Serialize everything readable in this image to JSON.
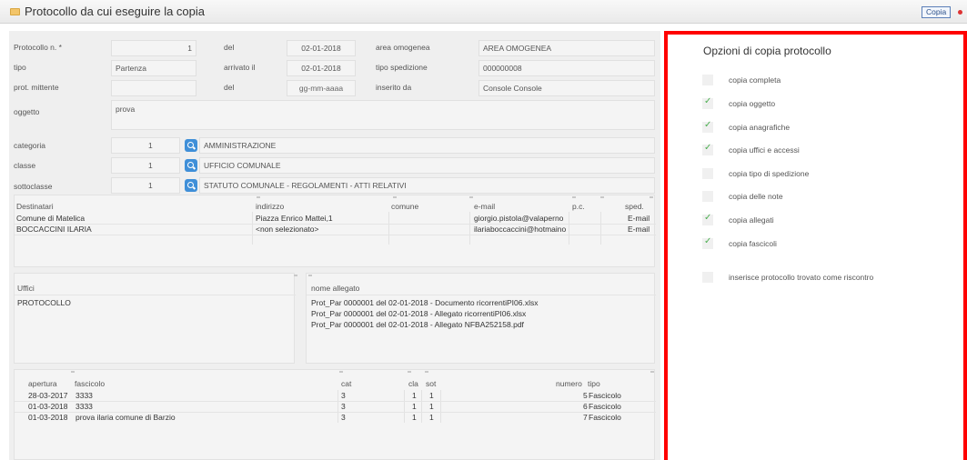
{
  "window": {
    "title": "Protocollo da cui eseguire la copia",
    "copy_button": "Copia"
  },
  "form": {
    "protocollo_label": "Protocollo n. *",
    "protocollo_value": "1",
    "del_label": "del",
    "del_value": "02-01-2018",
    "area_label": "area omogenea",
    "area_value": "AREA OMOGENEA",
    "tipo_label": "tipo",
    "tipo_value": "Partenza",
    "arrivato_label": "arrivato il",
    "arrivato_value": "02-01-2018",
    "spedizione_label": "tipo spedizione",
    "spedizione_value": "000000008",
    "mittente_label": "prot. mittente",
    "mittente_value": "",
    "del2_label": "del",
    "del2_placeholder": "gg-mm-aaaa",
    "inserito_label": "inserito da",
    "inserito_value": "Console Console",
    "oggetto_label": "oggetto",
    "oggetto_value": "prova",
    "categoria_label": "categoria",
    "categoria_num": "1",
    "categoria_value": "AMMINISTRAZIONE",
    "classe_label": "classe",
    "classe_num": "1",
    "classe_value": "UFFICIO COMUNALE",
    "sottoclasse_label": "sottoclasse",
    "sottoclasse_num": "1",
    "sottoclasse_value": "STATUTO COMUNALE - REGOLAMENTI - ATTI RELATIVI"
  },
  "destinatari": {
    "headers": [
      "Destinatari",
      "indirizzo",
      "comune",
      "e-mail",
      "p.c.",
      "sped."
    ],
    "rows": [
      [
        "Comune di Matelica",
        "Piazza Enrico Mattei,1",
        "",
        "giorgio.pistola@valaperno",
        "",
        "E-mail"
      ],
      [
        "BOCCACCINI ILARIA",
        "<non selezionato>",
        "",
        "ilariaboccaccini@hotmaino",
        "",
        "E-mail"
      ]
    ]
  },
  "uffici": {
    "header": "Uffici",
    "rows": [
      "PROTOCOLLO"
    ]
  },
  "allegati": {
    "header": "nome allegato",
    "rows": [
      "Prot_Par 0000001 del 02-01-2018 - Documento ricorrentiPI06.xlsx",
      "Prot_Par 0000001 del 02-01-2018 - Allegato ricorrentiPI06.xlsx",
      "Prot_Par 0000001 del 02-01-2018 - Allegato NFBA252158.pdf"
    ]
  },
  "fascicoli": {
    "headers": [
      "apertura",
      "fascicolo",
      "cat",
      "cla",
      "sot",
      "numero",
      "tipo"
    ],
    "rows": [
      [
        "28-03-2017",
        "3333",
        "3",
        "1",
        "1",
        "5",
        "Fascicolo"
      ],
      [
        "01-03-2018",
        "3333",
        "3",
        "1",
        "1",
        "6",
        "Fascicolo"
      ],
      [
        "01-03-2018",
        "prova ilaria comune di Barzio",
        "3",
        "1",
        "1",
        "7",
        "Fascicolo"
      ]
    ]
  },
  "options": {
    "title": "Opzioni di copia protocollo",
    "items": [
      {
        "label": "copia completa",
        "checked": false
      },
      {
        "label": "copia oggetto",
        "checked": true
      },
      {
        "label": "copia anagrafiche",
        "checked": true
      },
      {
        "label": "copia uffici e accessi",
        "checked": true
      },
      {
        "label": "copia tipo di spedizione",
        "checked": false
      },
      {
        "label": "copia delle note",
        "checked": false
      },
      {
        "label": "copia allegati",
        "checked": true
      },
      {
        "label": "copia fascicoli",
        "checked": true
      },
      {
        "label": "inserisce protocollo trovato come riscontro",
        "checked": false
      }
    ],
    "check_glyph": "✓"
  },
  "colors": {
    "accent": "#3f8fd8",
    "highlight_border": "#ff0000",
    "check": "#4caf50"
  }
}
